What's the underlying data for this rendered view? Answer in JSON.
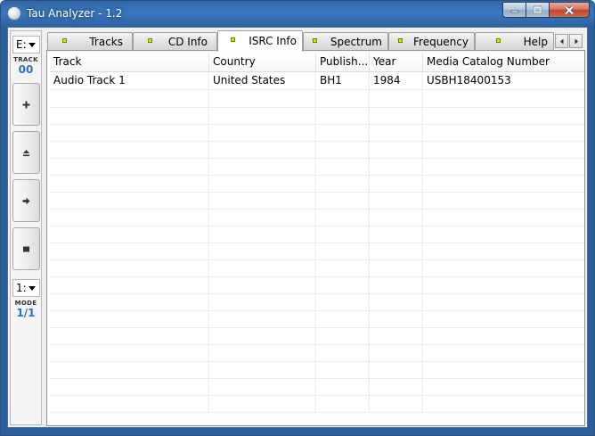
{
  "window": {
    "title": "Tau Analyzer - 1.2",
    "accent": "#2a5f9e"
  },
  "caption_buttons": {
    "minimize_icon": "minimize-icon",
    "maximize_icon": "maximize-icon",
    "close_icon": "close-icon"
  },
  "sidebar": {
    "drive": "E:",
    "track_caption": "TRACK",
    "track_value": "00",
    "buttons": [
      {
        "name": "add",
        "icon": "plus-icon"
      },
      {
        "name": "eject",
        "icon": "eject-icon"
      },
      {
        "name": "play",
        "icon": "arrow-right-icon"
      },
      {
        "name": "stop",
        "icon": "stop-icon"
      }
    ],
    "mode_select": "1:",
    "mode_caption": "MODE",
    "mode_value": "1/1"
  },
  "tabs": [
    {
      "label": "Tracks",
      "active": false
    },
    {
      "label": "CD Info",
      "active": false
    },
    {
      "label": "ISRC Info",
      "active": true
    },
    {
      "label": "Spectrum",
      "active": false
    },
    {
      "label": "Frequency",
      "active": false
    },
    {
      "label": "Help",
      "active": false
    }
  ],
  "tab_led_color": "#c6f000",
  "table": {
    "columns": [
      "Track",
      "Country",
      "Publish...",
      "Year",
      "Media Catalog Number"
    ],
    "rows": [
      [
        "Audio Track 1",
        "United States",
        "BH1",
        "1984",
        "USBH18400153"
      ]
    ]
  }
}
